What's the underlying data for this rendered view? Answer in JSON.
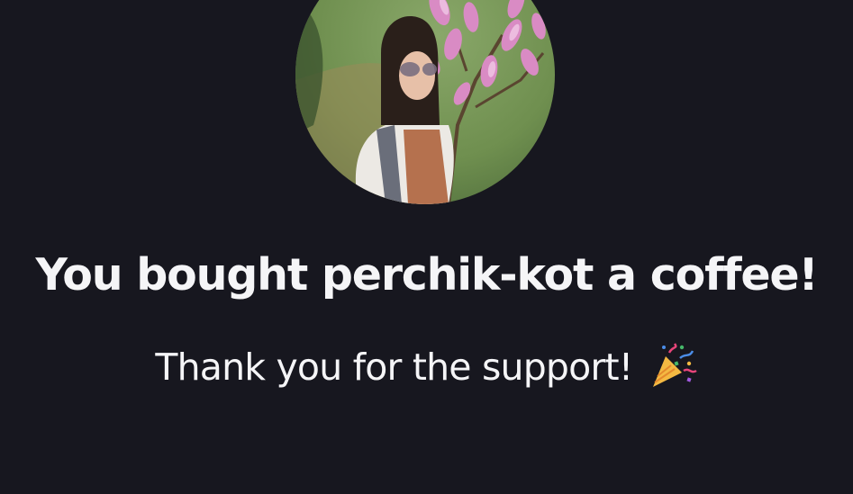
{
  "profile": {
    "avatar_icon": "profile-photo"
  },
  "success": {
    "headline": "You bought perchik-kot a coffee!",
    "message": "Thank you for the support!",
    "message_icon": "party-popper-icon"
  },
  "colors": {
    "background": "#17171f",
    "text": "#f5f5f7"
  }
}
